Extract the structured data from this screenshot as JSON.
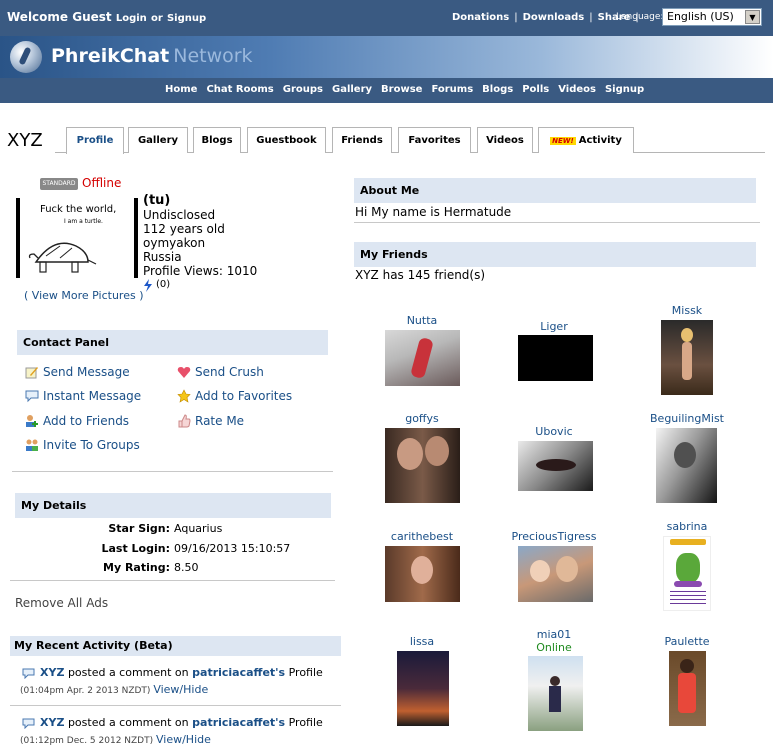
{
  "topbar": {
    "welcome": "Welcome Guest",
    "login": "Login",
    "or": "or",
    "signup": "Signup",
    "links": [
      "Donations",
      "Downloads",
      "Share"
    ],
    "language_label": "Language:",
    "language_value": "English (US)"
  },
  "brand": {
    "name": "PhreikChat",
    "suffix": "Network"
  },
  "nav": [
    "Home",
    "Chat Rooms",
    "Groups",
    "Gallery",
    "Browse",
    "Forums",
    "Blogs",
    "Polls",
    "Videos",
    "Signup"
  ],
  "profile": {
    "username": "XYZ",
    "tabs": [
      "Profile",
      "Gallery",
      "Blogs",
      "Guestbook",
      "Friends",
      "Favorites",
      "Videos",
      "Activity"
    ],
    "new_badge": "NEW!",
    "badge": "STANDARD",
    "status": "Offline",
    "avatar_caption": "Fuck the world,",
    "avatar_sub": "I am a turtle.",
    "nickname": "(tu)",
    "gender": "Undisclosed",
    "age": "112 years old",
    "city": "oymyakon",
    "country": "Russia",
    "views": "Profile Views: 1010",
    "rating_count": "(0)",
    "view_more": "( View More Pictures )"
  },
  "contact": {
    "title": "Contact Panel",
    "items": [
      "Send Message",
      "Send Crush",
      "Instant Message",
      "Add to Favorites",
      "Add to Friends",
      "Rate Me",
      "Invite To Groups"
    ]
  },
  "details": {
    "title": "My Details",
    "rows": [
      {
        "label": "Star Sign:",
        "value": "Aquarius"
      },
      {
        "label": "Last Login:",
        "value": "09/16/2013 15:10:57"
      },
      {
        "label": "My Rating:",
        "value": "8.50"
      }
    ]
  },
  "remove_ads": "Remove All Ads",
  "activity": {
    "title": "My Recent Activity (Beta)",
    "items": [
      {
        "user": "XYZ",
        "action": "posted a comment on",
        "target": "patriciacaffet's",
        "object": "Profile",
        "time": "(01:04pm Apr. 2 2013 NZDT)",
        "toggle": "View/Hide"
      },
      {
        "user": "XYZ",
        "action": "posted a comment on",
        "target": "patriciacaffet's",
        "object": "Profile",
        "time": "(01:12pm Dec. 5 2012 NZDT)",
        "toggle": "View/Hide"
      }
    ]
  },
  "about": {
    "title": "About Me",
    "text": "Hi My name is Hermatude"
  },
  "friends": {
    "title": "My Friends",
    "count_text": "XYZ has 145 friend(s)",
    "list": [
      {
        "name": "Nutta",
        "status": ""
      },
      {
        "name": "Liger",
        "status": ""
      },
      {
        "name": "Missk",
        "status": ""
      },
      {
        "name": "goffys",
        "status": ""
      },
      {
        "name": "Ubovic",
        "status": ""
      },
      {
        "name": "BeguilingMist",
        "status": ""
      },
      {
        "name": "carithebest",
        "status": ""
      },
      {
        "name": "PreciousTigress",
        "status": ""
      },
      {
        "name": "sabrina",
        "status": ""
      },
      {
        "name": "lissa",
        "status": ""
      },
      {
        "name": "mia01",
        "status": "Online"
      },
      {
        "name": "Paulette",
        "status": ""
      }
    ]
  },
  "colors": {
    "header": "#3a5a82",
    "panel": "#dde6f2",
    "link": "#1a4f87",
    "offline": "#d40000",
    "online": "#1f8a1f"
  }
}
